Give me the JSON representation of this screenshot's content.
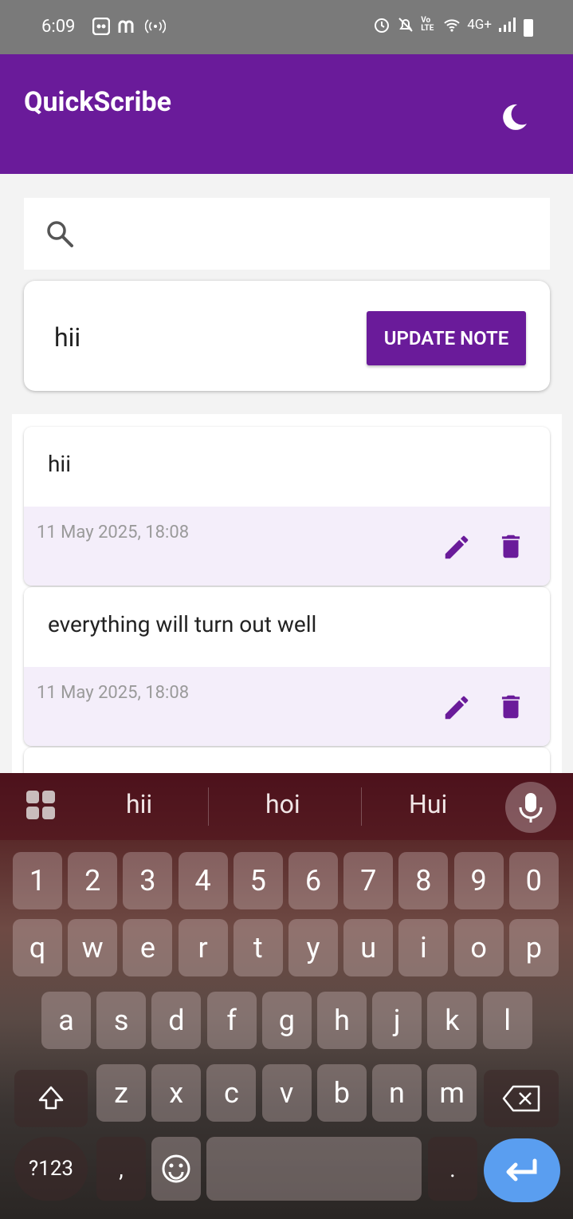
{
  "status": {
    "time": "6:09",
    "network": "4G+",
    "volte": "Vo LTE"
  },
  "app": {
    "title": "QuickScribe"
  },
  "search": {
    "placeholder": ""
  },
  "editor": {
    "text": "hii",
    "button_label": "UPDATE NOTE"
  },
  "notes": [
    {
      "text": "hii",
      "date": "11 May 2025, 18:08"
    },
    {
      "text": "everything will turn out well",
      "date": "11 May 2025, 18:08"
    }
  ],
  "keyboard": {
    "suggestions": [
      "hii",
      "hoi",
      "Hui"
    ],
    "row_numbers": [
      "1",
      "2",
      "3",
      "4",
      "5",
      "6",
      "7",
      "8",
      "9",
      "0"
    ],
    "row1": [
      "q",
      "w",
      "e",
      "r",
      "t",
      "y",
      "u",
      "i",
      "o",
      "p"
    ],
    "row2": [
      "a",
      "s",
      "d",
      "f",
      "g",
      "h",
      "j",
      "k",
      "l"
    ],
    "row3": [
      "z",
      "x",
      "c",
      "v",
      "b",
      "n",
      "m"
    ],
    "symbols_label": "?123",
    "comma": ",",
    "period": "."
  },
  "colors": {
    "primary": "#6a1b9a",
    "note_footer": "#f4eefa",
    "enter_key": "#5a9ef0"
  }
}
